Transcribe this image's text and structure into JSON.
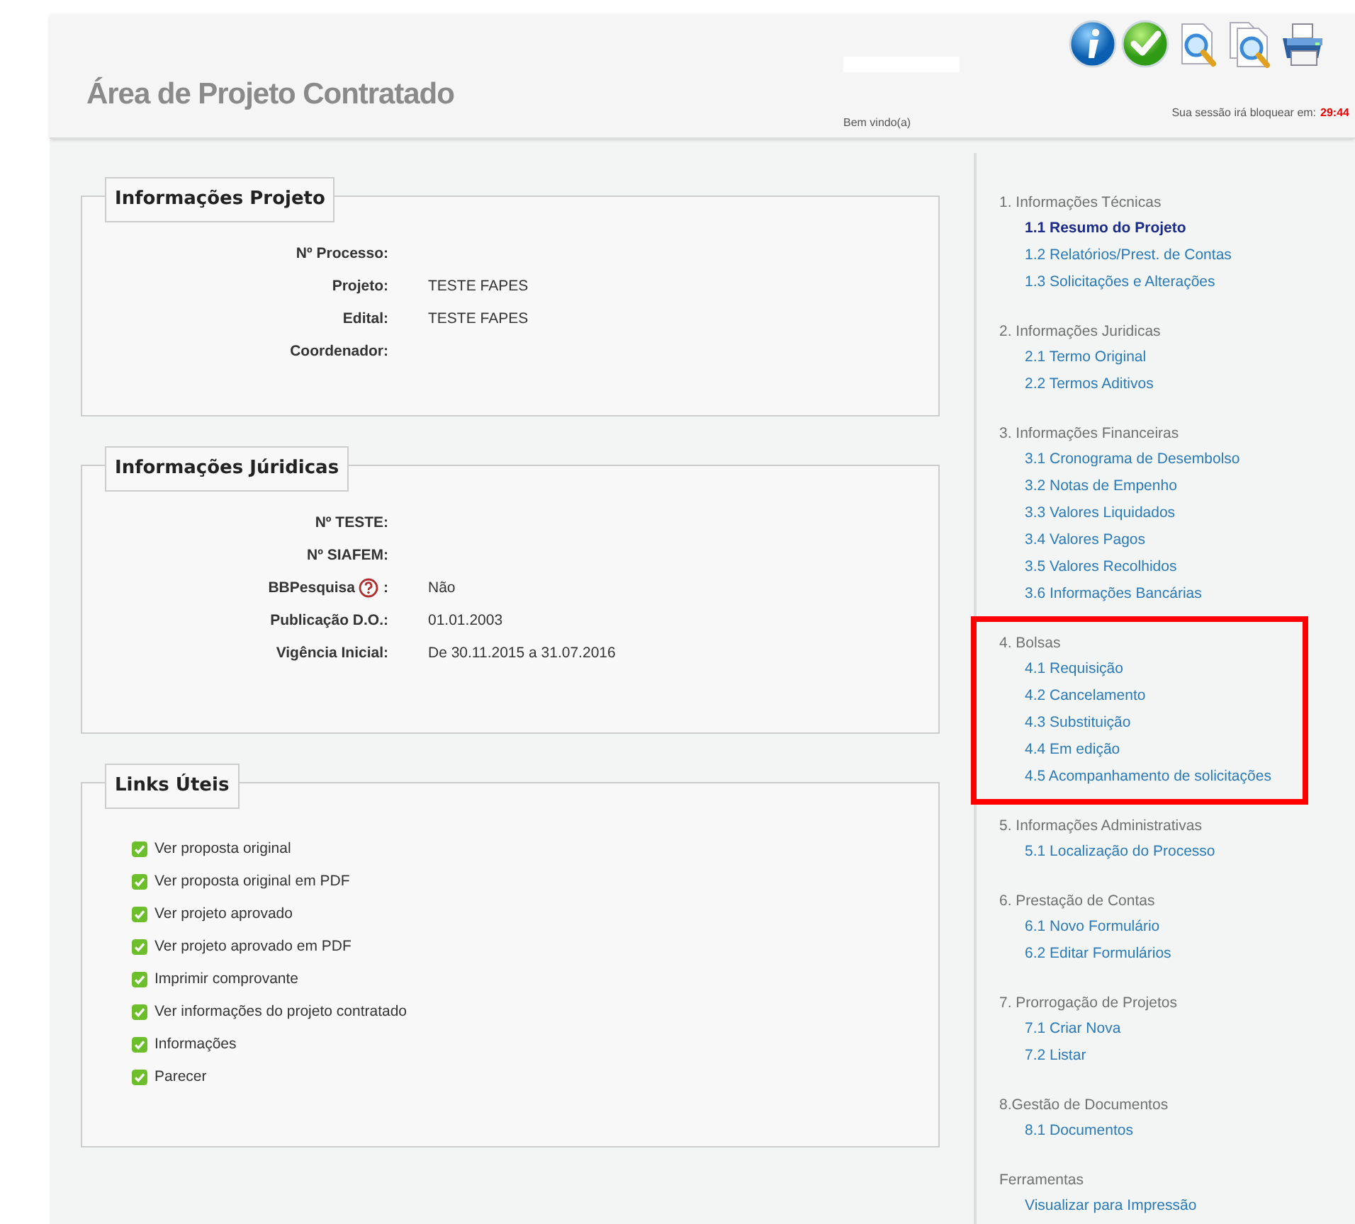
{
  "header": {
    "title": "Área de Projeto Contratado",
    "welcome": "Bem vindo(a)",
    "session_label": "Sua sessão irá bloquear em:",
    "session_time": "29:44",
    "tools": [
      {
        "kind": "info"
      },
      {
        "kind": "check"
      },
      {
        "kind": "zoom"
      },
      {
        "kind": "zoom-pages"
      },
      {
        "kind": "print"
      }
    ]
  },
  "sections": [
    {
      "title": "Informações Projeto",
      "kind": "fields",
      "rows": [
        {
          "label": "Nº Processo:"
        },
        {
          "label": "Projeto:",
          "value": "TESTE FAPES"
        },
        {
          "label": "Edital:",
          "value": "TESTE FAPES"
        },
        {
          "label": "Coordenador:"
        }
      ]
    },
    {
      "title": "Informações Júridicas",
      "kind": "fields",
      "rows": [
        {
          "label": "Nº TESTE:"
        },
        {
          "label": "Nº SIAFEM:"
        },
        {
          "label": "BBPesquisa",
          "help_icon": true,
          "after_icon": ":",
          "value": "Não"
        },
        {
          "label": "Publicação D.O.:",
          "value": "01.01.2003"
        },
        {
          "label": "Vigência Inicial:",
          "value": "De 30.11.2015 a 31.07.2016"
        }
      ]
    },
    {
      "title": "Links Úteis",
      "kind": "links",
      "links": [
        "Ver proposta original",
        "Ver proposta original em PDF",
        "Ver projeto aprovado",
        "Ver projeto aprovado em PDF",
        "Imprimir comprovante",
        "Ver informações do projeto contratado",
        "Informações",
        "Parecer"
      ]
    }
  ],
  "sidebar": [
    {
      "heading": "1. Informações Técnicas",
      "highlighted": false,
      "items": [
        {
          "label": "1.1 Resumo do Projeto",
          "selected": true
        },
        {
          "label": "1.2 Relatórios/Prest. de Contas",
          "selected": false
        },
        {
          "label": "1.3 Solicitações e Alterações",
          "selected": false
        }
      ]
    },
    {
      "heading": "2. Informações Juridicas",
      "highlighted": false,
      "items": [
        {
          "label": "2.1 Termo Original",
          "selected": false
        },
        {
          "label": "2.2 Termos Aditivos",
          "selected": false
        }
      ]
    },
    {
      "heading": "3. Informações Financeiras",
      "highlighted": false,
      "items": [
        {
          "label": "3.1 Cronograma de Desembolso",
          "selected": false
        },
        {
          "label": "3.2 Notas de Empenho",
          "selected": false
        },
        {
          "label": "3.3 Valores Liquidados",
          "selected": false
        },
        {
          "label": "3.4 Valores Pagos",
          "selected": false
        },
        {
          "label": "3.5 Valores Recolhidos",
          "selected": false
        },
        {
          "label": "3.6 Informações Bancárias",
          "selected": false
        }
      ]
    },
    {
      "heading": "4. Bolsas",
      "highlighted": true,
      "items": [
        {
          "label": "4.1 Requisição",
          "selected": false
        },
        {
          "label": "4.2 Cancelamento",
          "selected": false
        },
        {
          "label": "4.3 Substituição",
          "selected": false
        },
        {
          "label": "4.4 Em edição",
          "selected": false
        },
        {
          "label": "4.5 Acompanhamento de solicitações",
          "selected": false
        }
      ]
    },
    {
      "heading": "5. Informações Administrativas",
      "highlighted": false,
      "items": [
        {
          "label": "5.1 Localização do Processo",
          "selected": false
        }
      ]
    },
    {
      "heading": "6. Prestação de Contas",
      "highlighted": false,
      "items": [
        {
          "label": "6.1 Novo Formulário",
          "selected": false
        },
        {
          "label": "6.2 Editar Formulários",
          "selected": false
        }
      ]
    },
    {
      "heading": "7. Prorrogação de Projetos",
      "highlighted": false,
      "items": [
        {
          "label": "7.1 Criar Nova",
          "selected": false
        },
        {
          "label": "7.2 Listar",
          "selected": false
        }
      ]
    },
    {
      "heading": "8.Gestão de Documentos",
      "highlighted": false,
      "items": [
        {
          "label": "8.1 Documentos",
          "selected": false
        }
      ]
    },
    {
      "heading": "Ferramentas",
      "highlighted": false,
      "items": [
        {
          "label": "Visualizar para Impressão",
          "selected": false
        }
      ]
    }
  ]
}
